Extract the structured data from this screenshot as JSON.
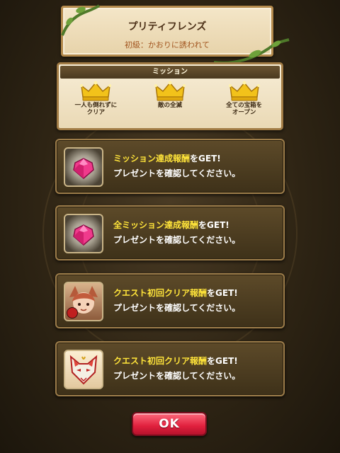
{
  "quest": {
    "title": "プリティフレンズ",
    "subtitle": "初級：かおりに誘われて"
  },
  "missions": {
    "header": "ミッション",
    "items": [
      {
        "label": "一人も倒れずに\nクリア",
        "icon": "crown-icon"
      },
      {
        "label": "敵の全滅",
        "icon": "crown-icon"
      },
      {
        "label": "全ての宝箱を\nオープン",
        "icon": "crown-icon"
      }
    ]
  },
  "rewards": [
    {
      "highlight": "ミッション達成報酬",
      "suffix": "をGET!",
      "message": "プレゼントを確認してください。",
      "icon": "gem-icon"
    },
    {
      "highlight": "全ミッション達成報酬",
      "suffix": "をGET!",
      "message": "プレゼントを確認してください。",
      "icon": "gem-icon"
    },
    {
      "highlight": "クエスト初回クリア報酬",
      "suffix": "をGET!",
      "message": "プレゼントを確認してください。",
      "icon": "character-portrait-icon"
    },
    {
      "highlight": "クエスト初回クリア報酬",
      "suffix": "をGET!",
      "message": "プレゼントを確認してください。",
      "icon": "fox-mask-icon"
    }
  ],
  "ok_button": {
    "label": "OK"
  },
  "colors": {
    "highlight": "#ffe43a",
    "ok_button": "#e0203d",
    "crown": "#f2c21a"
  }
}
